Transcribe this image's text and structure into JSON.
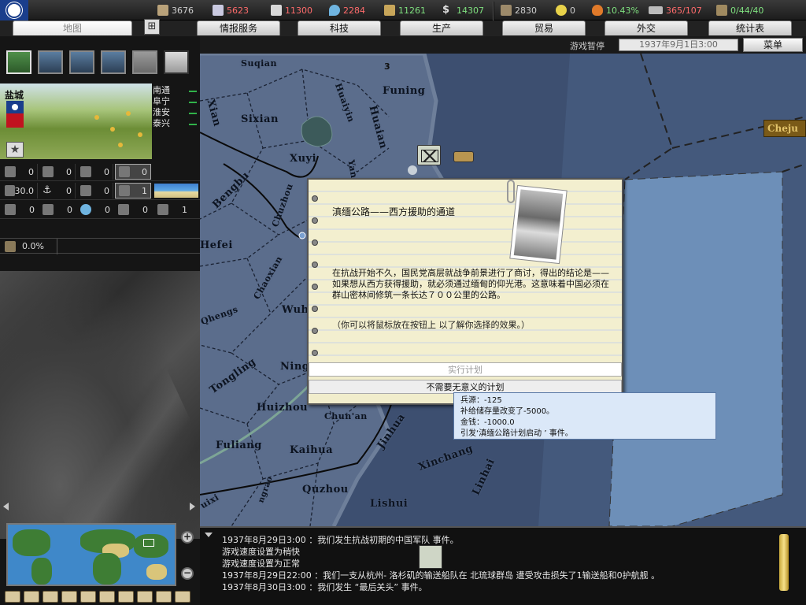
{
  "resources": [
    {
      "icon": "energy-icon",
      "value": "3676",
      "color": "#cfcfcf"
    },
    {
      "icon": "metal-icon",
      "value": "5623",
      "color": "#ff6b6b"
    },
    {
      "icon": "rare-materials-icon",
      "value": "11300",
      "color": "#ff6b6b"
    },
    {
      "icon": "oil-icon",
      "value": "2284",
      "color": "#ff6b6b"
    },
    {
      "icon": "supplies-icon",
      "value": "11261",
      "color": "#7fe07f"
    },
    {
      "icon": "money-icon",
      "value": "14307",
      "color": "#7fe07f"
    },
    {
      "icon": "manpower-icon",
      "value": "2830",
      "color": "#cfcfcf"
    },
    {
      "icon": "nuclear-icon",
      "value": "0",
      "color": "#cfcfcf"
    },
    {
      "icon": "dissent-icon",
      "value": "10.43%",
      "color": "#7fe07f"
    },
    {
      "icon": "transport-icon",
      "value": "365/107",
      "color": "#ff6b6b"
    },
    {
      "icon": "convoy-icon",
      "value": "0/44/40",
      "color": "#7fe07f"
    }
  ],
  "tabs": [
    {
      "label": "地图",
      "active": true
    },
    {
      "label": "情报服务",
      "active": false
    },
    {
      "label": "科技",
      "active": false
    },
    {
      "label": "生产",
      "active": false
    },
    {
      "label": "贸易",
      "active": false
    },
    {
      "label": "外交",
      "active": false
    },
    {
      "label": "统计表",
      "active": false
    }
  ],
  "status": {
    "pause_label": "游戏暂停",
    "date": "1937年9月1日3:00",
    "menu_label": "菜单"
  },
  "province": {
    "name": "盐城",
    "neighbors": [
      "南通",
      "阜宁",
      "淮安",
      "泰兴"
    ]
  },
  "stats": {
    "row1": [
      "0",
      "0",
      "0",
      "0"
    ],
    "row2": [
      "30.0",
      "0",
      "0",
      "1"
    ],
    "row3": [
      "0",
      "0",
      "0",
      "0",
      "1"
    ],
    "infrastructure": "0.0%"
  },
  "map": {
    "marker": "3",
    "cheju_label": "Cheju",
    "cities": [
      {
        "name": "Suqian"
      },
      {
        "name": "Funing"
      },
      {
        "name": "Sixian"
      },
      {
        "name": "Huaiyin"
      },
      {
        "name": "Huaian"
      },
      {
        "name": "Xuyi"
      },
      {
        "name": "Yan"
      },
      {
        "name": "Bengbu"
      },
      {
        "name": "Chuzhou"
      },
      {
        "name": "Hefei"
      },
      {
        "name": "Chaoxian"
      },
      {
        "name": "Wuhu"
      },
      {
        "name": "Tongling"
      },
      {
        "name": "Ning"
      },
      {
        "name": "Huizhou"
      },
      {
        "name": "Chun'an"
      },
      {
        "name": "Fuliang"
      },
      {
        "name": "Kaihua"
      },
      {
        "name": "Jinhua"
      },
      {
        "name": "Xinchang"
      },
      {
        "name": "Quzhou"
      },
      {
        "name": "Lishui"
      },
      {
        "name": "Linhai"
      },
      {
        "name": "Xian"
      },
      {
        "name": "Qhengs"
      },
      {
        "name": "uixi"
      },
      {
        "name": "ngrao"
      }
    ]
  },
  "event": {
    "title": "滇缅公路——西方援助的通道",
    "body": "在抗战开始不久，国民党高层就战争前景进行了商讨，得出的结论是——如果想从西方获得援助，就必须通过缅甸的仰光港。这意味着中国必须在群山密林间修筑一条长达７００公里的公路。",
    "hint": "（你可以将鼠标放在按钮上 以了解你选择的效果。）",
    "choice1": "实行计划",
    "choice2": "不需要无意义的计划"
  },
  "tooltip": {
    "line1": "兵源：-125",
    "line2": "补给储存量改变了-5000。",
    "line3": "金钱：-1000.0",
    "line4": "引发‘滇缅公路计划启动 ’ 事件。"
  },
  "log": [
    "1937年8月29日3:00  ：我们发生抗战初期的中国军队 事件。",
    "游戏速度设置为稍快",
    "游戏速度设置为正常",
    "1937年8月29日22:00 ：我们一支从杭州- 洛杉矶的输送船队在 北琉球群岛 遭受攻击损失了1输送船和0护航舰 。",
    "1937年8月30日3:00  ：我们发生  “最后关头” 事件。"
  ]
}
